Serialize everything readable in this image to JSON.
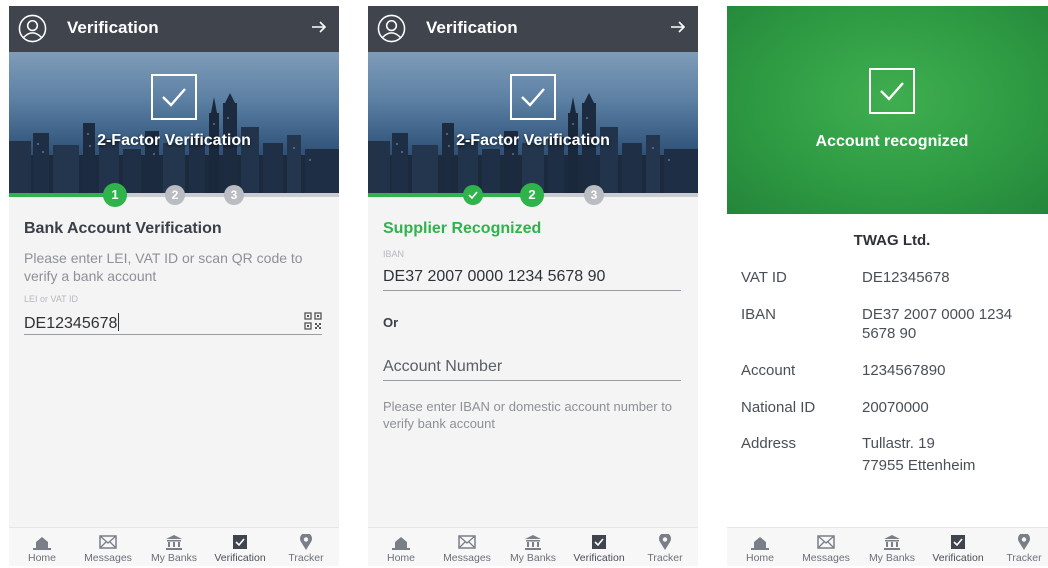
{
  "screens": [
    {
      "header": {
        "title": "Verification"
      },
      "hero": {
        "title": "2-Factor Verification"
      },
      "stepper": {
        "steps": [
          "1",
          "2",
          "3"
        ],
        "current": 1,
        "progress": 0.33
      },
      "section_title": "Bank Account Verification",
      "description": "Please enter LEI, VAT ID or scan QR code to verify a bank account",
      "field": {
        "label": "LEI or VAT ID",
        "value": "DE12345678"
      }
    },
    {
      "header": {
        "title": "Verification"
      },
      "hero": {
        "title": "2-Factor Verification"
      },
      "stepper": {
        "steps": [
          "✓",
          "2",
          "3"
        ],
        "current": 2,
        "progress": 0.5
      },
      "section_title": "Supplier Recognized",
      "iban": {
        "label": "IBAN",
        "value": "DE37 2007 0000 1234 5678 90"
      },
      "or_label": "Or",
      "account": {
        "placeholder": "Account Number"
      },
      "hint": "Please enter IBAN or domestic account number to verify bank account"
    },
    {
      "hero": {
        "title": "Account recognized"
      },
      "company": "TWAG Ltd.",
      "details": [
        {
          "key": "VAT ID",
          "value": "DE12345678"
        },
        {
          "key": "IBAN",
          "value": "DE37 2007 0000 1234 5678 90"
        },
        {
          "key": "Account",
          "value": "1234567890"
        },
        {
          "key": "National ID",
          "value": "20070000"
        },
        {
          "key": "Address",
          "value": "Tullastr. 19",
          "value2": "77955 Ettenheim"
        }
      ]
    }
  ],
  "bottom_nav": [
    {
      "label": "Home",
      "icon": "home-icon"
    },
    {
      "label": "Messages",
      "icon": "mail-icon"
    },
    {
      "label": "My Banks",
      "icon": "bank-icon"
    },
    {
      "label": "Verification",
      "icon": "check-square-icon",
      "active": true
    },
    {
      "label": "Tracker",
      "icon": "map-pin-icon"
    }
  ],
  "colors": {
    "brand_green": "#2fb34a",
    "header": "#3f444d",
    "inactive_step": "#b9bcc1"
  }
}
